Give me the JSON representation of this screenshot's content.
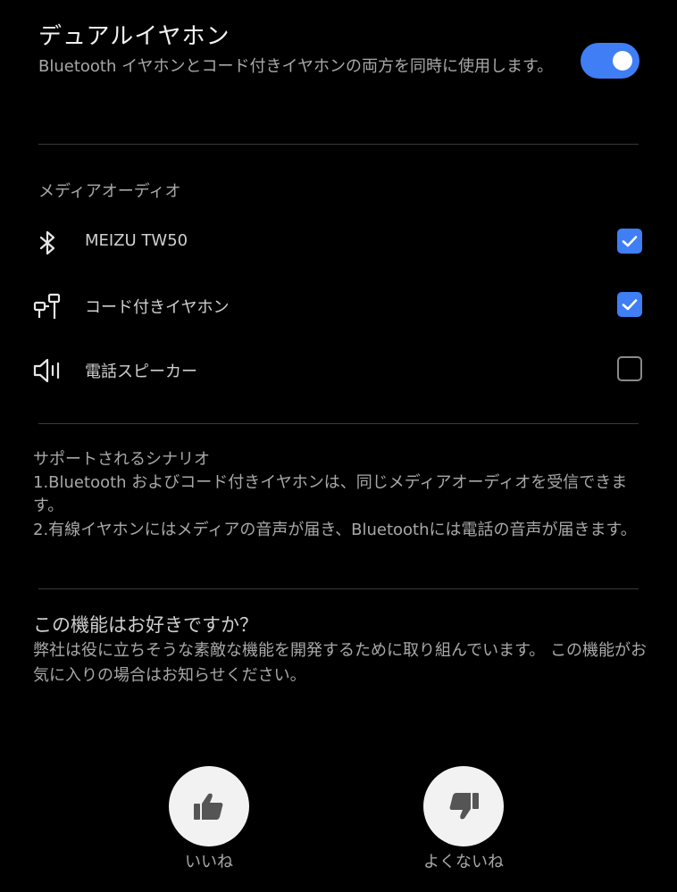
{
  "header": {
    "title": "デュアルイヤホン",
    "subtitle": "Bluetooth イヤホンとコード付きイヤホンの両方を同時に使用します。",
    "toggle_on": true
  },
  "media_audio": {
    "section_label": "メディアオーディオ",
    "devices": [
      {
        "name": "MEIZU TW50",
        "icon": "bluetooth-icon",
        "checked": true
      },
      {
        "name": "コード付きイヤホン",
        "icon": "wired-earphone-icon",
        "checked": true
      },
      {
        "name": "電話スピーカー",
        "icon": "speaker-icon",
        "checked": false
      }
    ]
  },
  "scenarios": {
    "title": "サポートされるシナリオ",
    "line1": "1.Bluetooth およびコード付きイヤホンは、同じメディアオーディオを受信できます。",
    "line2": "2.有線イヤホンにはメディアの音声が届き、Bluetoothには電話の音声が届きます。"
  },
  "feedback": {
    "question": "この機能はお好きですか？",
    "text": "弊社は役に立ちそうな素敵な機能を開発するために取り組んでいます。 この機能がお気に入りの場合はお知らせください。",
    "like_label": "いいね",
    "dislike_label": "よくないね"
  },
  "colors": {
    "accent": "#3f7ef5",
    "background": "#000000",
    "text_primary": "#f2f2f2",
    "text_secondary": "#a8a8a8"
  }
}
